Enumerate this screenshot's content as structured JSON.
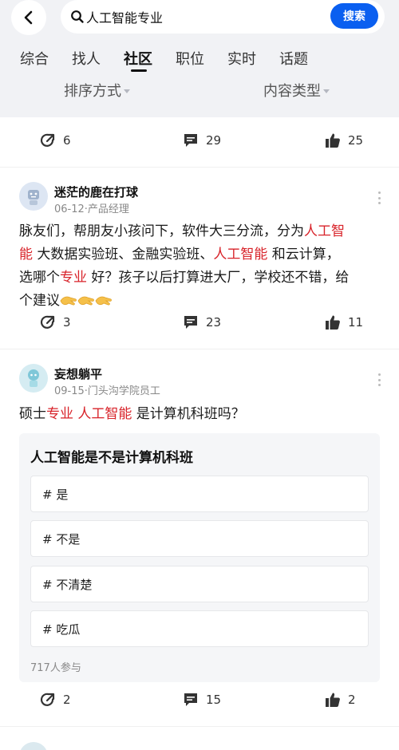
{
  "search": {
    "query": "人工智能专业",
    "button_label": "搜索"
  },
  "tabs": [
    "综合",
    "找人",
    "社区",
    "职位",
    "实时",
    "话题"
  ],
  "active_tab": "社区",
  "filters": {
    "sort_label": "排序方式",
    "type_label": "内容类型"
  },
  "post0": {
    "shares": "6",
    "comments": "29",
    "likes": "25"
  },
  "post1": {
    "author": "迷茫的鹿在打球",
    "meta": "06-12·产品经理",
    "text": {
      "p1": "脉友们，帮朋友小孩问下，软件大三分流，分为",
      "h1": "人工智",
      "h1b": "能",
      "p2": " 大数据实验班、金融实验班、",
      "h2": "人工智能",
      "p3": " 和云计算，",
      "p4": "选哪个",
      "h3": "专业",
      "p5": " 好？孩子以后打算进大厂，学校还不错，给",
      "p6": "个建议"
    },
    "shares": "3",
    "comments": "23",
    "likes": "11",
    "emoji": "clap-emoji"
  },
  "post2": {
    "author": "妄想躺平",
    "meta": "09-15·门头沟学院员工",
    "text": {
      "p1": "硕士",
      "h1": "专业",
      "sp": " ",
      "h2": "人工智能",
      "p2": " 是计算机科班吗？"
    },
    "poll": {
      "title": "人工智能是不是计算机科班",
      "options": [
        "# 是",
        "# 不是",
        "# 不清楚",
        "# 吃瓜"
      ],
      "participants": "717人参与"
    },
    "shares": "2",
    "comments": "15",
    "likes": "2"
  },
  "colors": {
    "accent": "#0a5ff0",
    "highlight": "#d8232a",
    "header_bg": "#f1f2f5"
  },
  "icons": [
    "back-arrow-icon",
    "search-icon",
    "share-icon",
    "comment-icon",
    "like-icon",
    "more-icon"
  ]
}
